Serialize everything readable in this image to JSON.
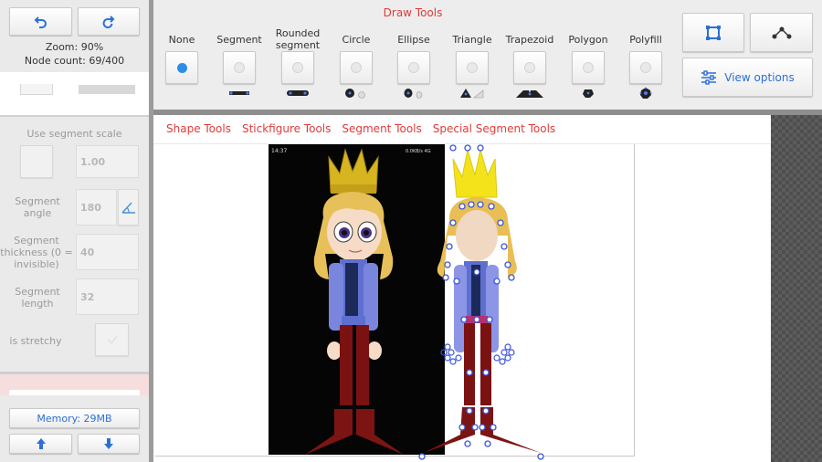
{
  "left_panel": {
    "zoom": "Zoom: 90%",
    "node_count": "Node count: 69/400",
    "use_segment_scale_label": "Use segment scale",
    "segment_scale_value": "1.00",
    "segment_angle_label": "Segment angle",
    "segment_angle_value": "180",
    "segment_thickness_label": "Segment thickness (0 = invisible)",
    "segment_thickness_value": "40",
    "segment_length_label": "Segment length",
    "segment_length_value": "32",
    "is_stretchy_label": "is stretchy",
    "memory": "Memory: 29MB"
  },
  "toolbar": {
    "title": "Draw Tools",
    "tools": [
      {
        "label": "None",
        "selected": true
      },
      {
        "label": "Segment",
        "selected": false
      },
      {
        "label": "Rounded segment",
        "selected": false
      },
      {
        "label": "Circle",
        "selected": false
      },
      {
        "label": "Ellipse",
        "selected": false
      },
      {
        "label": "Triangle",
        "selected": false
      },
      {
        "label": "Trapezoid",
        "selected": false
      },
      {
        "label": "Polygon",
        "selected": false
      },
      {
        "label": "Polyfill",
        "selected": false
      }
    ],
    "view_options": "View options"
  },
  "tabs": [
    "Shape Tools",
    "Stickfigure Tools",
    "Segment Tools",
    "Special Segment Tools"
  ],
  "reference_image": {
    "status_time": "14:37",
    "status_right": "0.0KB/s  4G"
  },
  "colors": {
    "accent_red": "#e23a3a",
    "link_blue": "#2c6fd6",
    "selected_dot": "#2e8ee6",
    "node_blue": "#3a55d8"
  }
}
